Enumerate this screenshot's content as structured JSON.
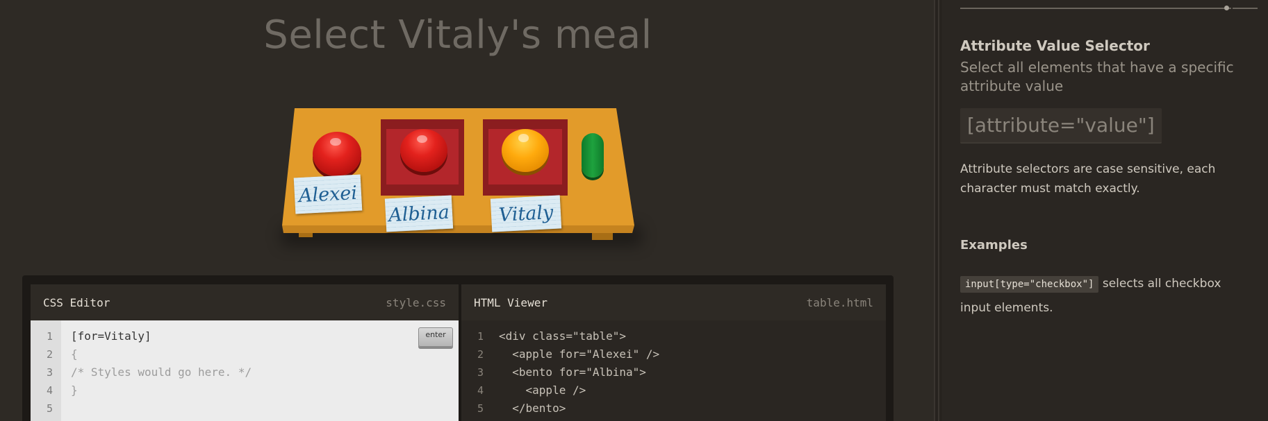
{
  "level": {
    "title": "Select Vitaly's meal",
    "tags": [
      "Alexei",
      "Albina",
      "Vitaly"
    ]
  },
  "css_editor": {
    "title": "CSS Editor",
    "file": "style.css",
    "enter_label": "enter",
    "line_numbers": [
      "1",
      "2",
      "3",
      "4",
      "5"
    ],
    "input": "[for=Vitaly]",
    "line2": "{",
    "line3": "/* Styles would go here. */",
    "line4": "}"
  },
  "html_viewer": {
    "title": "HTML Viewer",
    "file": "table.html",
    "line_numbers": [
      "1",
      "2",
      "3",
      "4",
      "5"
    ],
    "lines": [
      "<div class=\"table\">",
      "  <apple for=\"Alexei\" />",
      "  <bento for=\"Albina\">",
      "    <apple />",
      "  </bento>"
    ]
  },
  "sidebar": {
    "selector_name": "Attribute Value Selector",
    "selector_title": "Select all elements that have a specific attribute value",
    "syntax": "[attribute=\"value\"]",
    "hint": "Attribute selectors are case sensitive, each character must match exactly.",
    "examples_heading": "Examples",
    "example_code": "input[type=\"checkbox\"]",
    "example_text": "selects all checkbox input elements."
  },
  "colors": {
    "background": "#2e2a25",
    "table": "#e29b2a",
    "apple": "#e3221d",
    "orange": "#ffaa0d",
    "pickle": "#1ea23e",
    "bento": "#8b1d1f"
  }
}
